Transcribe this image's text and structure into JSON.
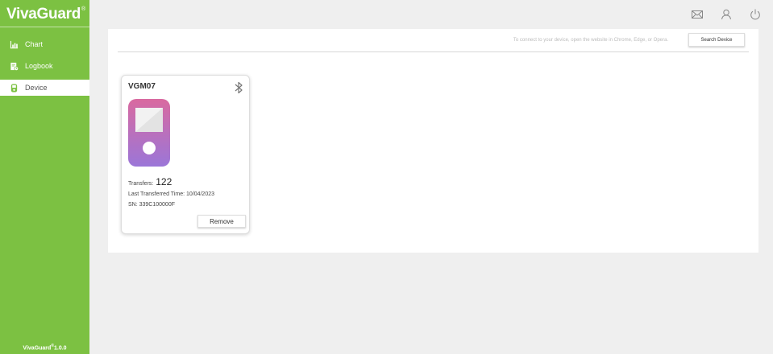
{
  "app": {
    "logo_text": "VivaGuard",
    "logo_reg": "®",
    "version_name": "VivaGuard",
    "version_reg": "®",
    "version_number": "1.0.0"
  },
  "sidebar": {
    "items": [
      {
        "label": "Chart",
        "icon": "chart-icon",
        "active": false
      },
      {
        "label": "Logbook",
        "icon": "logbook-icon",
        "active": false
      },
      {
        "label": "Device",
        "icon": "device-icon",
        "active": true
      }
    ]
  },
  "header": {
    "icons": [
      "mail-icon",
      "user-icon",
      "power-icon"
    ]
  },
  "main": {
    "hint": "To connect to your device, open the website in Chrome, Edge, or Opera.",
    "search_button": "Search Device",
    "device_card": {
      "title": "VGM07",
      "transfers_label": "Transfers:",
      "transfers_count": "122",
      "last_transferred": "Last Transferred Time: 10/04/2023",
      "sn": "SN: 339C100000F",
      "remove_button": "Remove"
    }
  },
  "colors": {
    "brand_green": "#7cc142",
    "device_gradient_top": "#d96aa0",
    "device_gradient_bottom": "#9b76d8"
  }
}
